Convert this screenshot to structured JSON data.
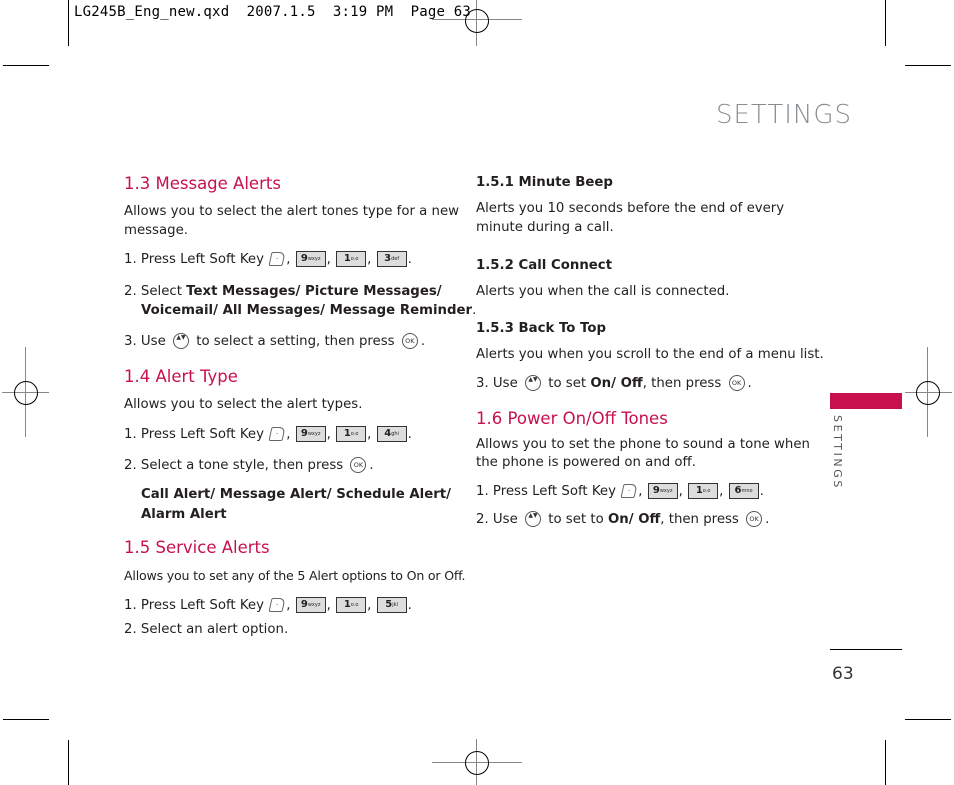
{
  "slug": {
    "filename": "LG245B_Eng_new.qxd",
    "date": "2007.1.5",
    "time": "3:19 PM",
    "page_label": "Page 63"
  },
  "header": {
    "title": "SETTINGS"
  },
  "side_tab": {
    "label": "SETTINGS",
    "accent_color": "#c8104f"
  },
  "page_number": "63",
  "icons": {
    "soft_key": "left-soft-key-icon",
    "nav": "navigation-key-icon",
    "ok": "ok-key-icon"
  },
  "left": {
    "s13": {
      "heading": "1.3 Message Alerts",
      "desc1": "Allows you to select the alert tones type for a new",
      "desc2": "message.",
      "step1": "1. Press Left Soft Key",
      "keys": [
        {
          "num": "9",
          "sub": "wxyz"
        },
        {
          "num": "1",
          "sub": "o.o"
        },
        {
          "num": "3",
          "sub": "def"
        }
      ],
      "step2_prefix": "2. Select ",
      "step2_opts_line1": "Text Messages/ Picture Messages/",
      "step2_opts_line2": "Voicemail/ All Messages/ Message Reminder",
      "step3_a": "3. Use",
      "step3_b": "to select a setting, then press"
    },
    "s14": {
      "heading": "1.4 Alert Type",
      "desc": "Allows you to select the alert types.",
      "step1": "1. Press Left Soft Key",
      "keys": [
        {
          "num": "9",
          "sub": "wxyz"
        },
        {
          "num": "1",
          "sub": "o.o"
        },
        {
          "num": "4",
          "sub": "ghi"
        }
      ],
      "step2": "2. Select a tone style, then press",
      "opts_line1": "Call Alert/ Message Alert/ Schedule Alert/",
      "opts_line2": "Alarm Alert"
    },
    "s15": {
      "heading": "1.5 Service Alerts",
      "desc": "Allows you to set any of the 5 Alert options to On or Off.",
      "step1": "1. Press Left Soft Key",
      "keys": [
        {
          "num": "9",
          "sub": "wxyz"
        },
        {
          "num": "1",
          "sub": "o.o"
        },
        {
          "num": "5",
          "sub": "jkl"
        }
      ],
      "step2": "2. Select an alert option."
    }
  },
  "right": {
    "s151": {
      "heading": "1.5.1 Minute Beep",
      "desc1": "Alerts you 10 seconds before the end of every",
      "desc2": "minute during a call."
    },
    "s152": {
      "heading": "1.5.2 Call Connect",
      "desc": "Alerts you when the call is connected."
    },
    "s153": {
      "heading": "1.5.3 Back To Top",
      "desc": "Alerts you when you scroll to the end of a menu list.",
      "step3_a": "3. Use",
      "step3_b": "to set ",
      "on_off": "On/ Off",
      "step3_c": ", then press"
    },
    "s16": {
      "heading": "1.6 Power On/Off Tones",
      "desc1": "Allows you to set the phone to sound a tone when",
      "desc2": "the phone is powered on and off.",
      "step1": "1. Press Left Soft Key",
      "keys": [
        {
          "num": "9",
          "sub": "wxyz"
        },
        {
          "num": "1",
          "sub": "o.o"
        },
        {
          "num": "6",
          "sub": "mno"
        }
      ],
      "step2_a": "2. Use",
      "step2_b": "to set to ",
      "on_off": "On/ Off",
      "step2_c": ", then press"
    }
  },
  "punct": {
    "comma": ",",
    "period": ".",
    "ok_glyph": "OK",
    "nav_glyph": "▲▼",
    "soft_glyph": "·"
  }
}
